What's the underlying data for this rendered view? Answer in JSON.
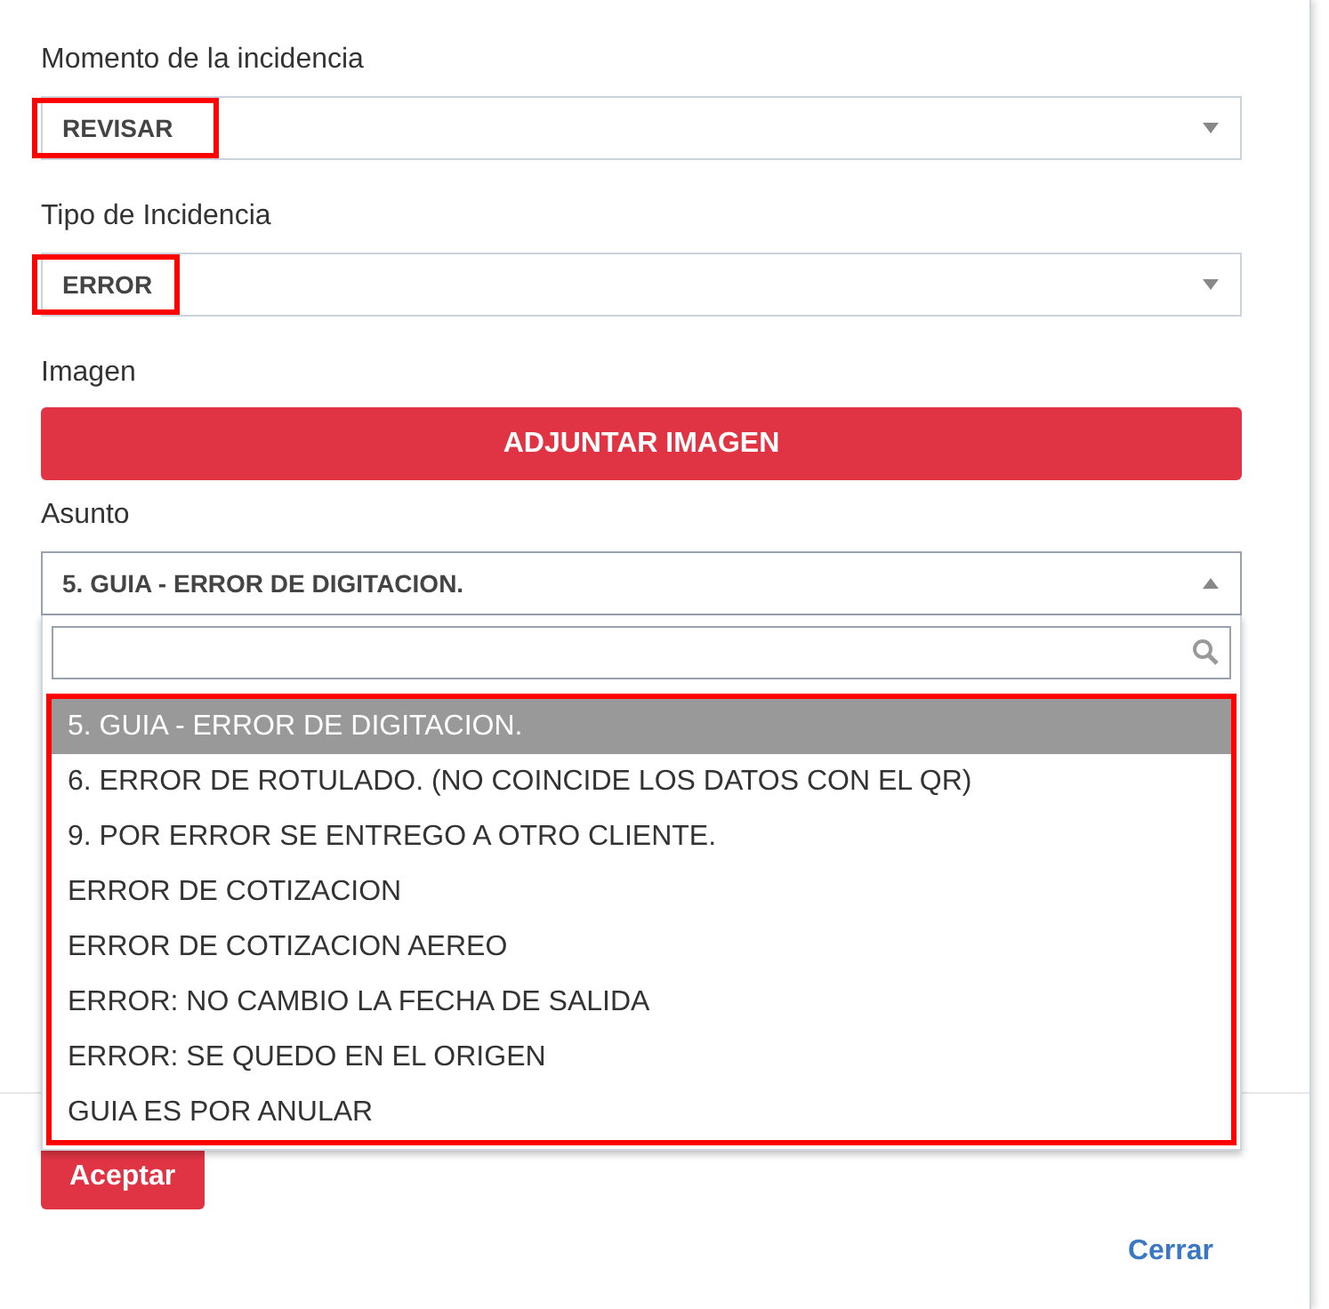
{
  "fields": [
    {
      "kind": "select",
      "label": "Momento de la incidencia",
      "value": "REVISAR",
      "highlighted": true
    },
    {
      "kind": "select",
      "label": "Tipo de Incidencia",
      "value": "ERROR",
      "highlighted": true
    },
    {
      "kind": "upload",
      "label": "Imagen",
      "button": "ADJUNTAR IMAGEN"
    },
    {
      "kind": "select",
      "label": "Asunto",
      "value": "5. GUIA - ERROR DE DIGITACION.",
      "expanded": true
    }
  ],
  "dropdown": {
    "highlighted": true,
    "options": [
      {
        "label": "5. GUIA - ERROR DE DIGITACION.",
        "selected": true
      },
      {
        "label": "6. ERROR DE ROTULADO. (NO COINCIDE LOS DATOS CON EL QR)",
        "selected": false
      },
      {
        "label": "9. POR ERROR SE ENTREGO A OTRO CLIENTE.",
        "selected": false
      },
      {
        "label": "ERROR DE COTIZACION",
        "selected": false
      },
      {
        "label": "ERROR DE COTIZACION AEREO",
        "selected": false
      },
      {
        "label": "ERROR: NO CAMBIO LA FECHA DE SALIDA",
        "selected": false
      },
      {
        "label": "ERROR: SE QUEDO EN EL ORIGEN",
        "selected": false
      },
      {
        "label": "GUIA ES POR ANULAR",
        "selected": false
      }
    ]
  },
  "footer": {
    "accept": "Aceptar",
    "close": "Cerrar"
  }
}
